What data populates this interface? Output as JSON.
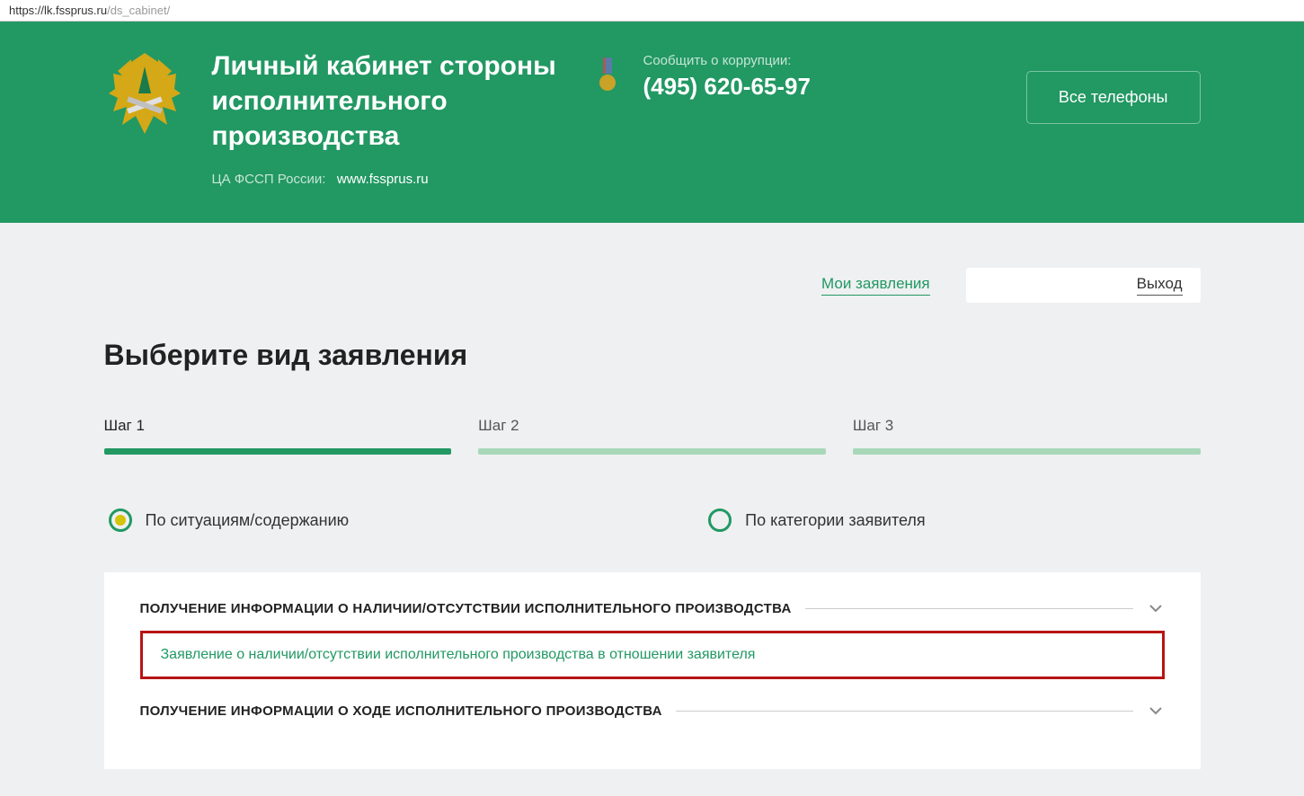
{
  "url": {
    "host": "https://lk.fssprus.ru",
    "path": "/ds_cabinet/"
  },
  "header": {
    "title": "Личный кабинет стороны исполнительного производства",
    "subtitle_prefix": "ЦА ФССП России:",
    "subtitle_link": "www.fssprus.ru",
    "contact_label": "Сообщить о коррупции:",
    "contact_phone": "(495) 620-65-97",
    "all_phones": "Все телефоны"
  },
  "topnav": {
    "my_applications": "Мои заявления",
    "logout": "Выход"
  },
  "page_title": "Выберите вид заявления",
  "steps": [
    {
      "label": "Шаг 1"
    },
    {
      "label": "Шаг 2"
    },
    {
      "label": "Шаг 3"
    }
  ],
  "radios": {
    "by_situation": "По ситуациям/содержанию",
    "by_category": "По категории заявителя"
  },
  "sections": [
    {
      "title": "ПОЛУЧЕНИЕ ИНФОРМАЦИИ О НАЛИЧИИ/ОТСУТСТВИИ ИСПОЛНИТЕЛЬНОГО ПРОИЗВОДСТВА"
    },
    {
      "title": "ПОЛУЧЕНИЕ ИНФОРМАЦИИ О ХОДЕ ИСПОЛНИТЕЛЬНОГО ПРОИЗВОДСТВА"
    }
  ],
  "highlighted_link": "Заявление о наличии/отсутствии исполнительного производства в отношении заявителя"
}
